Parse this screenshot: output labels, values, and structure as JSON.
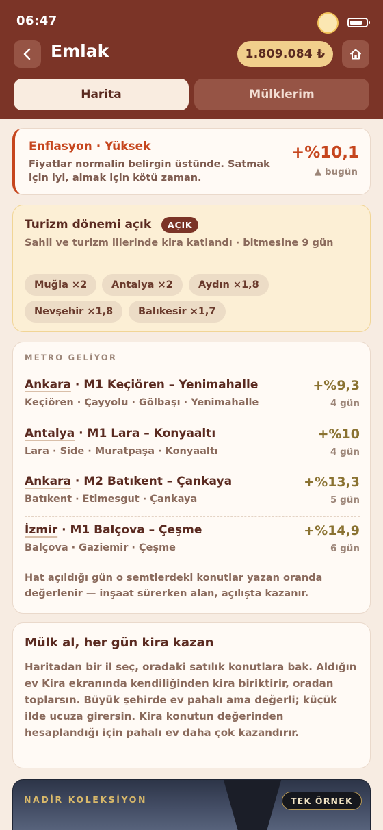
{
  "status": {
    "time": "06:47"
  },
  "header": {
    "title": "Emlak",
    "balance": "1.809.084 ₺"
  },
  "tabs": [
    {
      "label": "Harita"
    },
    {
      "label": "Mülklerim"
    }
  ],
  "inflation": {
    "title": "Enflasyon · Yüksek",
    "description": "Fiyatlar normalin belirgin üstünde. Satmak için iyi, almak için kötü zaman.",
    "value": "+%10,1",
    "trend": "▲ bugün"
  },
  "tourism": {
    "title": "Turizm dönemi açık",
    "badge": "AÇIK",
    "description": "Sahil ve turizm illerinde kira katlandı · bitmesine 9 gün",
    "chips": [
      "Muğla ×2",
      "Antalya ×2",
      "Aydın ×1,8",
      "Nevşehir ×1,8",
      "Balıkesir ×1,7"
    ]
  },
  "metro": {
    "label": "METRO GELİYOR",
    "lines": [
      {
        "city": "Ankara",
        "line": " · M1 Keçiören – Yenimahalle",
        "districts": "Keçiören · Çayyolu · Gölbaşı · Yenimahalle",
        "pct": "+%9,3",
        "days": "4 gün"
      },
      {
        "city": "Antalya",
        "line": " · M1 Lara – Konyaaltı",
        "districts": "Lara · Side · Muratpaşa · Konyaaltı",
        "pct": "+%10",
        "days": "4 gün"
      },
      {
        "city": "Ankara",
        "line": " · M2 Batıkent – Çankaya",
        "districts": "Batıkent · Etimesgut · Çankaya",
        "pct": "+%13,3",
        "days": "5 gün"
      },
      {
        "city": "İzmir",
        "line": " · M1 Balçova – Çeşme",
        "districts": "Balçova · Gaziemir · Çeşme",
        "pct": "+%14,9",
        "days": "6 gün"
      }
    ],
    "note": "Hat açıldığı gün o semtlerdeki konutlar yazan oranda değerlenir — inşaat sürerken alan, açılışta kazanır."
  },
  "buy": {
    "title": "Mülk al, her gün kira kazan",
    "description": "Haritadan bir il seç, oradaki satılık konutlara bak. Aldığın ev Kira ekranında kendiliğinden kira biriktirir, oradan toplarsın. Büyük şehirde ev pahalı ama değerli; küçük ilde ucuza girersin. Kira konutun değerinden hesaplandığı için pahalı ev daha çok kazandırır."
  },
  "collection": {
    "label": "NADİR KOLEKSİYON",
    "badge": "TEK ÖRNEK"
  },
  "icons": {
    "back": "chevron-left-icon",
    "home": "home-icon",
    "status": "sun-icon",
    "battery": "battery-icon"
  }
}
